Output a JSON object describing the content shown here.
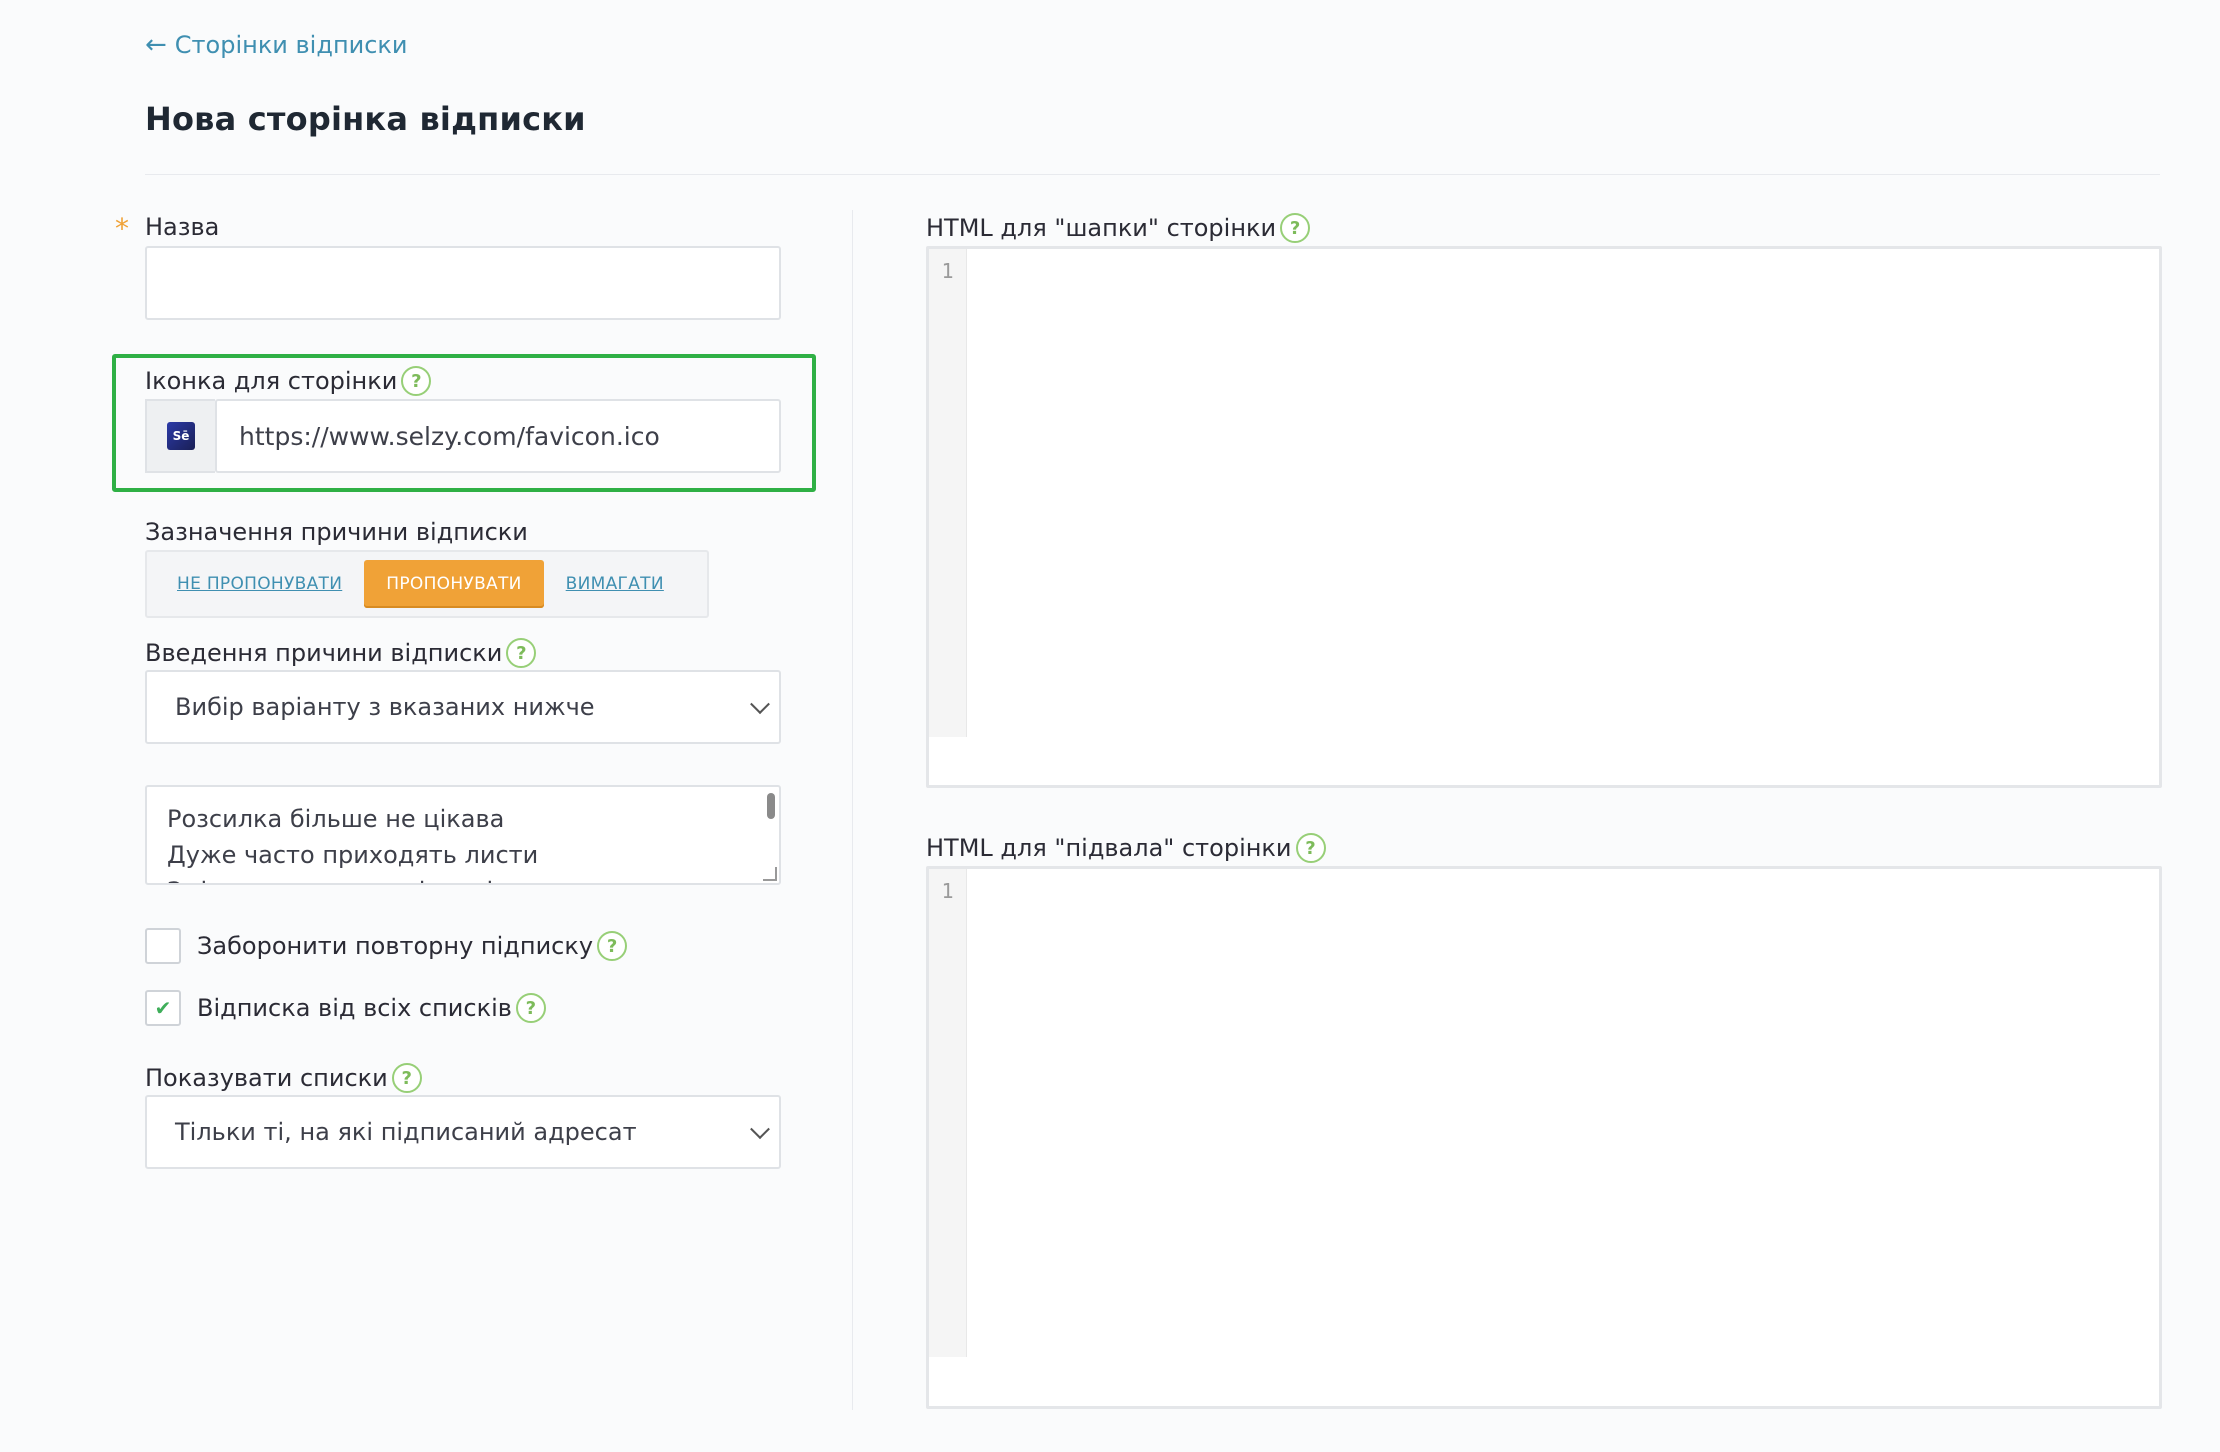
{
  "header": {
    "back_link": "Сторінки відписки",
    "back_arrow": "←",
    "title": "Нова сторінка відписки"
  },
  "form": {
    "name_label": "Назва",
    "required_mark": "*",
    "name_value": "",
    "icon_label": "Іконка для сторінки",
    "icon_url": "https://www.selzy.com/favicon.ico",
    "favicon_text": "Sē",
    "reason_label": "Зазначення причини відписки",
    "reason_options": [
      "НЕ ПРОПОНУВАТИ",
      "ПРОПОНУВАТИ",
      "ВИМАГАТИ"
    ],
    "reason_selected": "ПРОПОНУВАТИ",
    "reason_input_label": "Введення причини відписки",
    "reason_input_value": "Вибір варіанту з вказаних нижче",
    "reasons_text": [
      "Розсилка більше не цікава",
      "Дуже часто приходять листи",
      "Зміст розсилки не відповідає"
    ],
    "forbid_resubscribe_label": "Заборонити повторну підписку",
    "forbid_resubscribe_checked": false,
    "unsubscribe_all_label": "Відписка від всіх списків",
    "unsubscribe_all_checked": true,
    "check_mark": "✔",
    "show_lists_label": "Показувати списки",
    "show_lists_value": "Тільки ті, на які підписаний адресат"
  },
  "editors": {
    "header_label": "HTML для \"шапки\" сторінки",
    "footer_label": "HTML для \"підвала\" сторінки",
    "line_number": "1"
  },
  "help_glyph": "?",
  "colors": {
    "accent_orange": "#f0a237",
    "link_blue": "#3f8fb1",
    "highlight_green": "#2fb045",
    "help_green": "#7dbb5a"
  }
}
